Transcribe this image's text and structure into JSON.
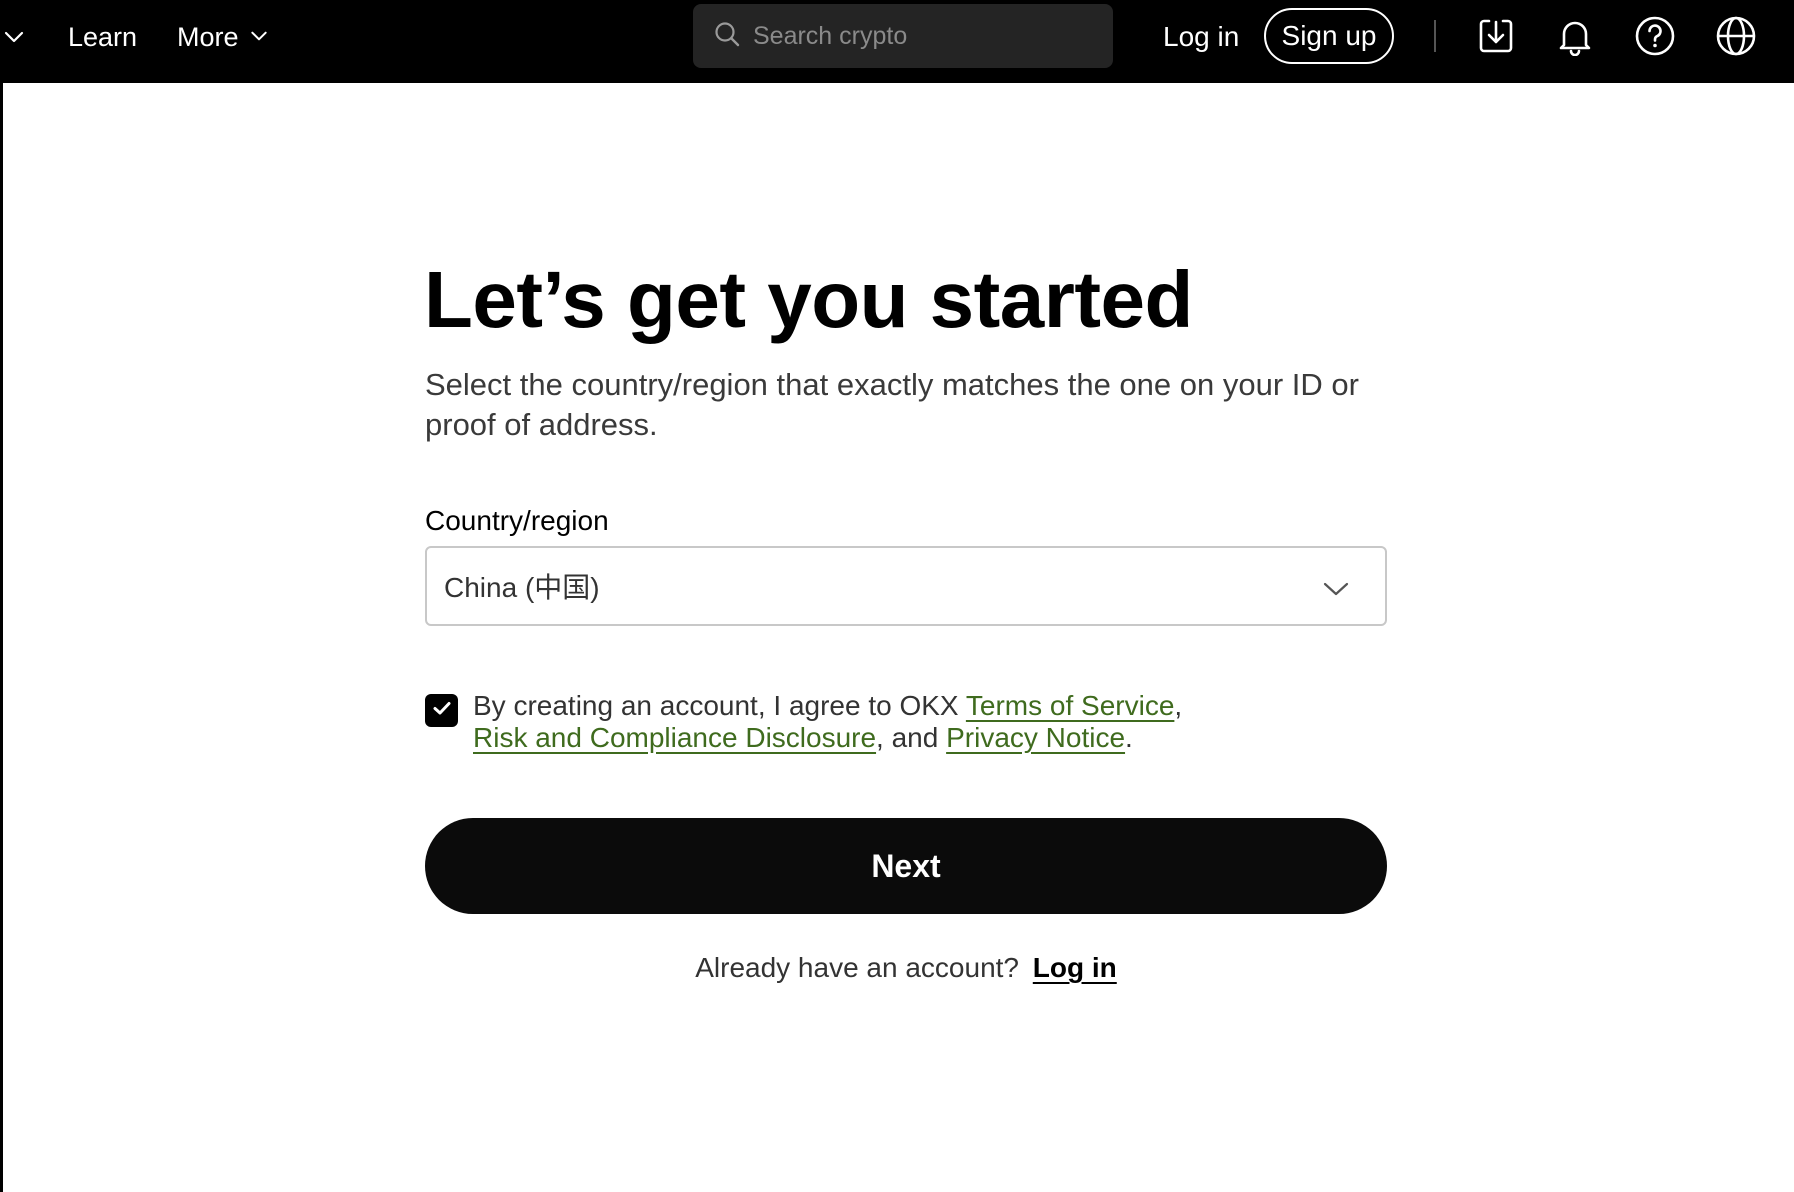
{
  "nav": {
    "learn_label": "Learn",
    "more_label": "More",
    "search_placeholder": "Search crypto",
    "login_label": "Log in",
    "signup_label": "Sign up",
    "icons": [
      "chevron-down-icon",
      "search-icon",
      "download-icon",
      "bell-icon",
      "help-icon",
      "globe-icon"
    ]
  },
  "main": {
    "title": "Let’s get you started",
    "subtitle": "Select the country/region that exactly matches the one on your ID or proof of address.",
    "country_label": "Country/region",
    "country_value": "China (中国)",
    "consent": {
      "checked": true,
      "prefix": "By creating an account, I agree to OKX ",
      "terms_link": "Terms of Service",
      "sep1": ",",
      "risk_link": "Risk and Compliance Disclosure",
      "sep2": ", and ",
      "privacy_link": "Privacy Notice",
      "suffix": "."
    },
    "next_label": "Next",
    "already_text": "Already have an account?",
    "login_link": "Log in"
  },
  "colors": {
    "topbar_bg": "#000000",
    "link_green": "#3f6b1e",
    "button_bg": "#0b0b0b"
  }
}
